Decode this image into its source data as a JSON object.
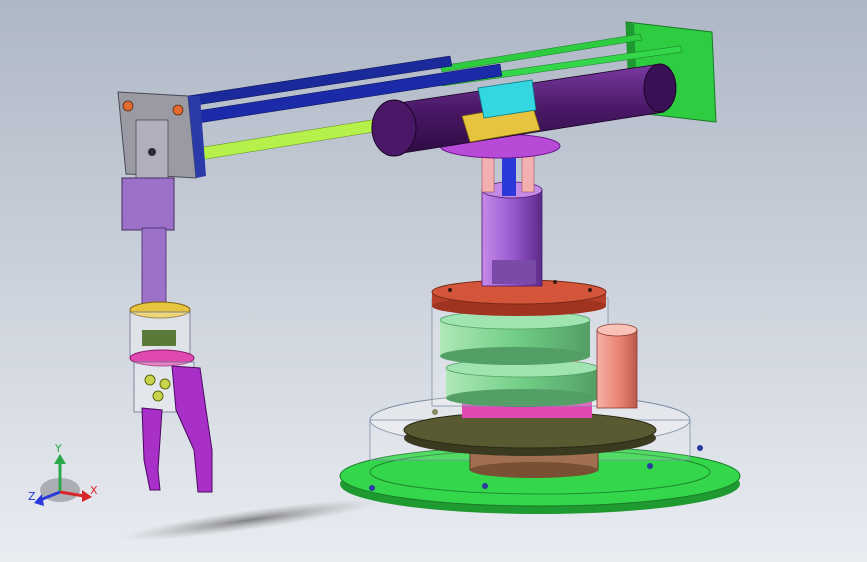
{
  "viewport": {
    "model": "robotic-arm-assembly"
  },
  "triad": {
    "x_label": "X",
    "y_label": "Y",
    "z_label": "Z",
    "x_color": "#d8262a",
    "y_color": "#2aa84a",
    "z_color": "#2a3ad8"
  },
  "colors": {
    "frame_green": "#2ecc40",
    "rod_blue": "#1a2a9a",
    "rod_lime": "#b6f04a",
    "cylinder_purple": "#5a1f7a",
    "clamp_cyan": "#34d6e0",
    "clamp_yellow": "#e6c440",
    "disc_magenta": "#b84ad8",
    "column_violet": "#9a5ad0",
    "disc_red": "#d4553a",
    "ring_green": "#4cbf6a",
    "ring_pink": "#e04ab0",
    "pillar_salmon": "#ee8a7a",
    "plate_olive": "#5a5a32",
    "hub_brown": "#a07050",
    "base_green": "#34d64a",
    "gripper_magenta": "#a830c8",
    "wrist_lavender": "#9b72c8",
    "plate_gray": "#9a9aa4"
  }
}
